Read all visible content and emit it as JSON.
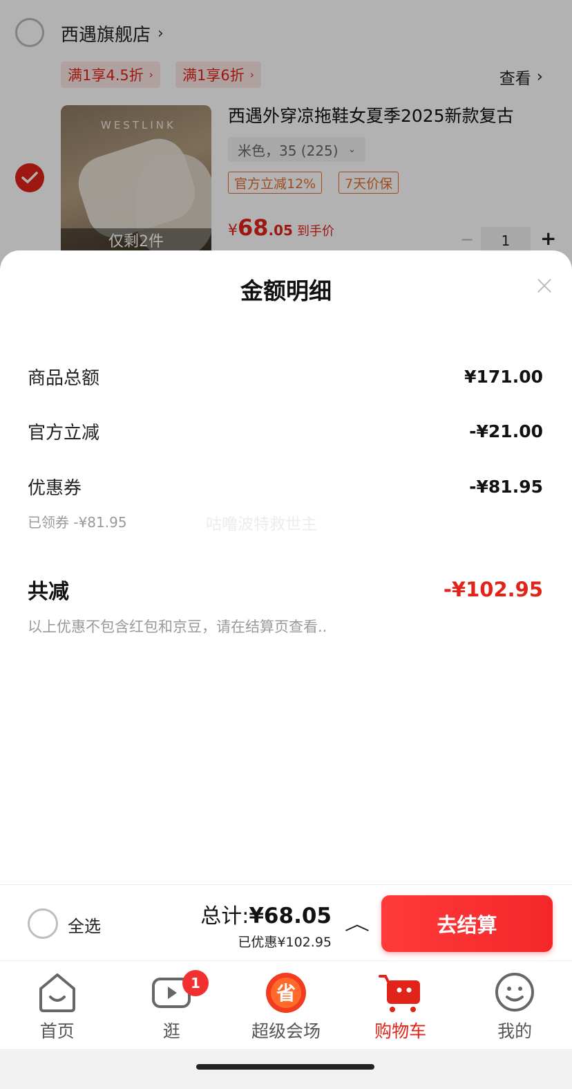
{
  "cart": {
    "shop_name": "西遇旗舰店",
    "promo_tags": [
      "满1享4.5折",
      "满1享6折"
    ],
    "view_label": "查看",
    "product": {
      "brand_text": "WESTLINK",
      "stock_text": "仅剩2件",
      "title": "西遇外穿凉拖鞋女夏季2025新款复古",
      "spec": "米色，35 (225)",
      "badges": [
        "官方立减12%",
        "7天价保"
      ],
      "price_currency": "¥",
      "price_int": "68",
      "price_dec": ".05",
      "price_suffix": "到手价",
      "quantity": "1"
    }
  },
  "sheet": {
    "title": "金额明细",
    "rows": [
      {
        "label": "商品总额",
        "value": "¥171.00"
      },
      {
        "label": "官方立减",
        "value": "-¥21.00"
      },
      {
        "label": "优惠券",
        "value": "-¥81.95"
      }
    ],
    "coupon_sub": "已领券 -¥81.95",
    "watermark": "咕噜波特救世主",
    "total_label": "共减",
    "total_value": "-¥102.95",
    "note": "以上优惠不包含红包和京豆，请在结算页查看.."
  },
  "checkout": {
    "select_all": "全选",
    "total_prefix": "总计:",
    "total_amount": "¥68.05",
    "saved": "已优惠¥102.95",
    "pay_label": "去结算"
  },
  "tabs": [
    {
      "label": "首页",
      "icon": "home-icon"
    },
    {
      "label": "逛",
      "icon": "video-icon"
    },
    {
      "label": "超级会场",
      "icon": "super-venue-icon"
    },
    {
      "label": "购物车",
      "icon": "cart-icon"
    },
    {
      "label": "我的",
      "icon": "profile-icon"
    }
  ],
  "notif_count": "1",
  "colors": {
    "accent": "#e2231a",
    "badge_orange": "#e46b2c"
  }
}
